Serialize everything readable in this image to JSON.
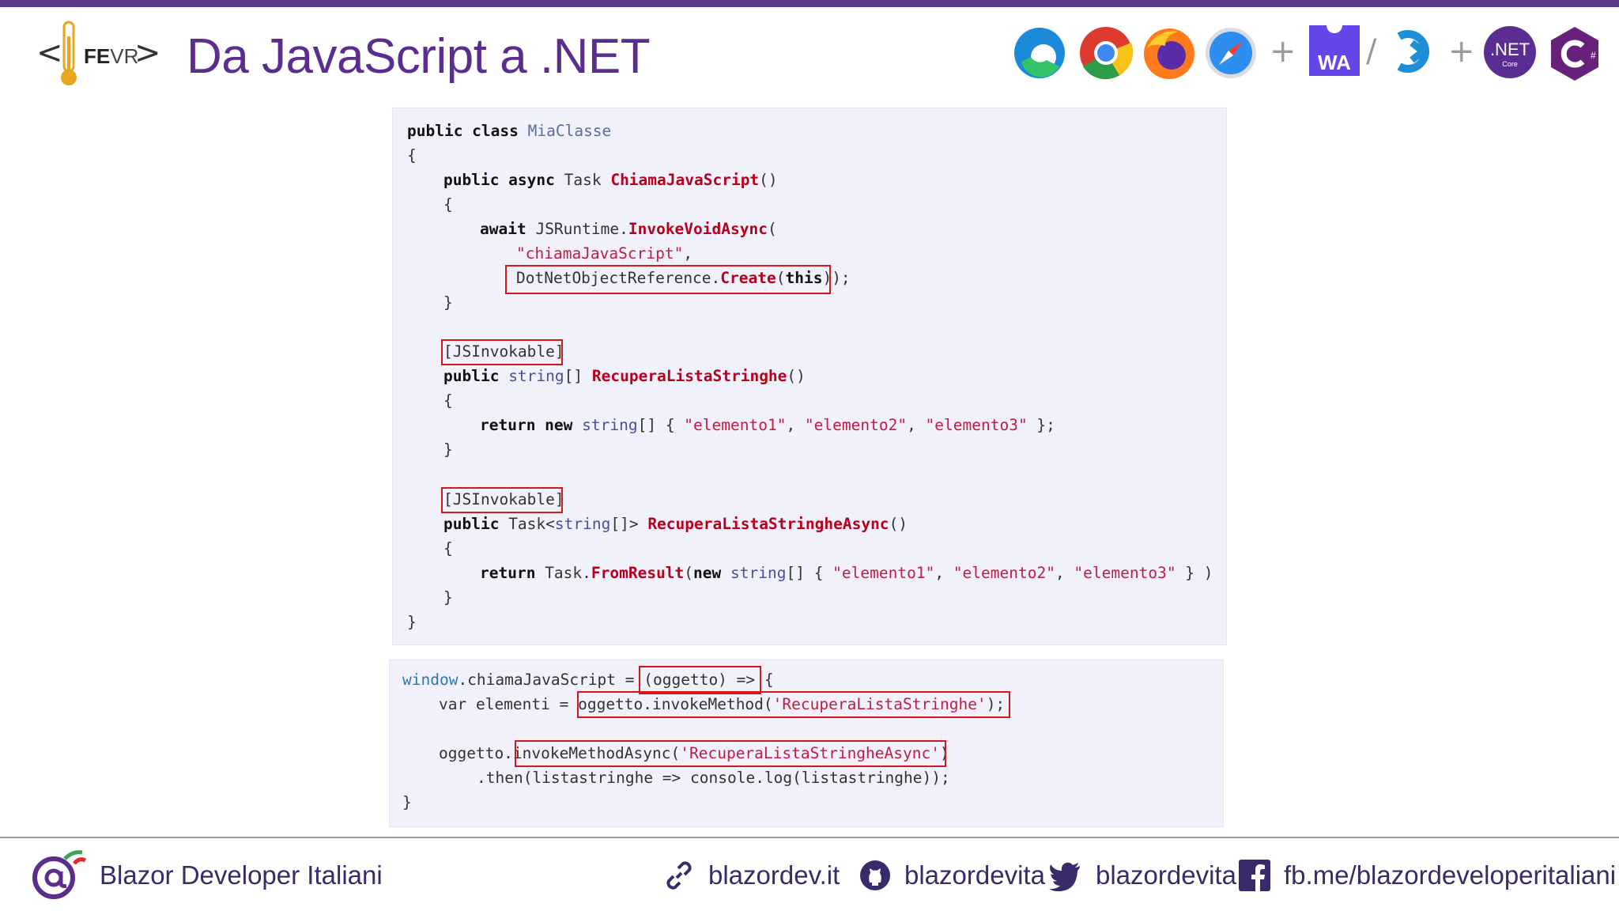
{
  "header": {
    "title": "Da JavaScript a .NET",
    "logo_text_bold": "FE",
    "logo_text_light": "VR"
  },
  "tech_icons": {
    "wa_label": "WA",
    "net_label": ".NET",
    "net_sub": "Core",
    "plus": "+",
    "slash": "/"
  },
  "csharp_code": {
    "lines": [
      [
        "public class ",
        "MiaClasse"
      ],
      [
        "{"
      ],
      [
        "public async ",
        "Task ",
        "ChiamaJavaScript",
        "()"
      ],
      [
        "{"
      ],
      [
        "await ",
        "JSRuntime.",
        "InvokeVoidAsync",
        "("
      ],
      [
        "\"chiamaJavaScript\"",
        ","
      ],
      [
        "DotNetObjectReference.",
        "Create",
        "(",
        "this",
        "));"
      ],
      [
        "}"
      ],
      [
        "[JSInvokable]"
      ],
      [
        "public ",
        "string",
        "[] ",
        "RecuperaListaStringhe",
        "()"
      ],
      [
        "{"
      ],
      [
        "return new ",
        "string",
        "[] { ",
        "\"elemento1\"",
        ", ",
        "\"elemento2\"",
        ", ",
        "\"elemento3\"",
        " };"
      ],
      [
        "}"
      ],
      [
        "[JSInvokable]"
      ],
      [
        "public ",
        "Task<",
        "string",
        "[]> ",
        "RecuperaListaStringheAsync",
        "()"
      ],
      [
        "{"
      ],
      [
        "return ",
        "Task.",
        "FromResult",
        "(",
        "new ",
        "string",
        "[] { ",
        "\"elemento1\"",
        ", ",
        "\"elemento2\"",
        ", ",
        "\"elemento3\"",
        " } )"
      ],
      [
        "}"
      ],
      [
        "}"
      ]
    ]
  },
  "js_code": {
    "lines": [
      [
        "window",
        ".chiamaJavaScript = ",
        "(oggetto) => ",
        "{"
      ],
      [
        "var elementi = ",
        "oggetto.invokeMethod(",
        "'RecuperaListaStringhe'",
        ");"
      ],
      [
        "oggetto.",
        "invokeMethodAsync(",
        "'RecuperaListaStringheAsync'",
        ")"
      ],
      [
        ".then(listastringhe => console.log(listastringhe));"
      ],
      [
        "}"
      ]
    ]
  },
  "footer": {
    "brand": "Blazor Developer Italiani",
    "site": "blazordev.it",
    "github": "blazordevita",
    "twitter": "blazordevita",
    "facebook": "fb.me/blazordeveloperitaliani"
  },
  "colors": {
    "accent": "#5b2d8e",
    "highlight_box": "#d9141b",
    "code_bg": "#f0f1fa"
  }
}
